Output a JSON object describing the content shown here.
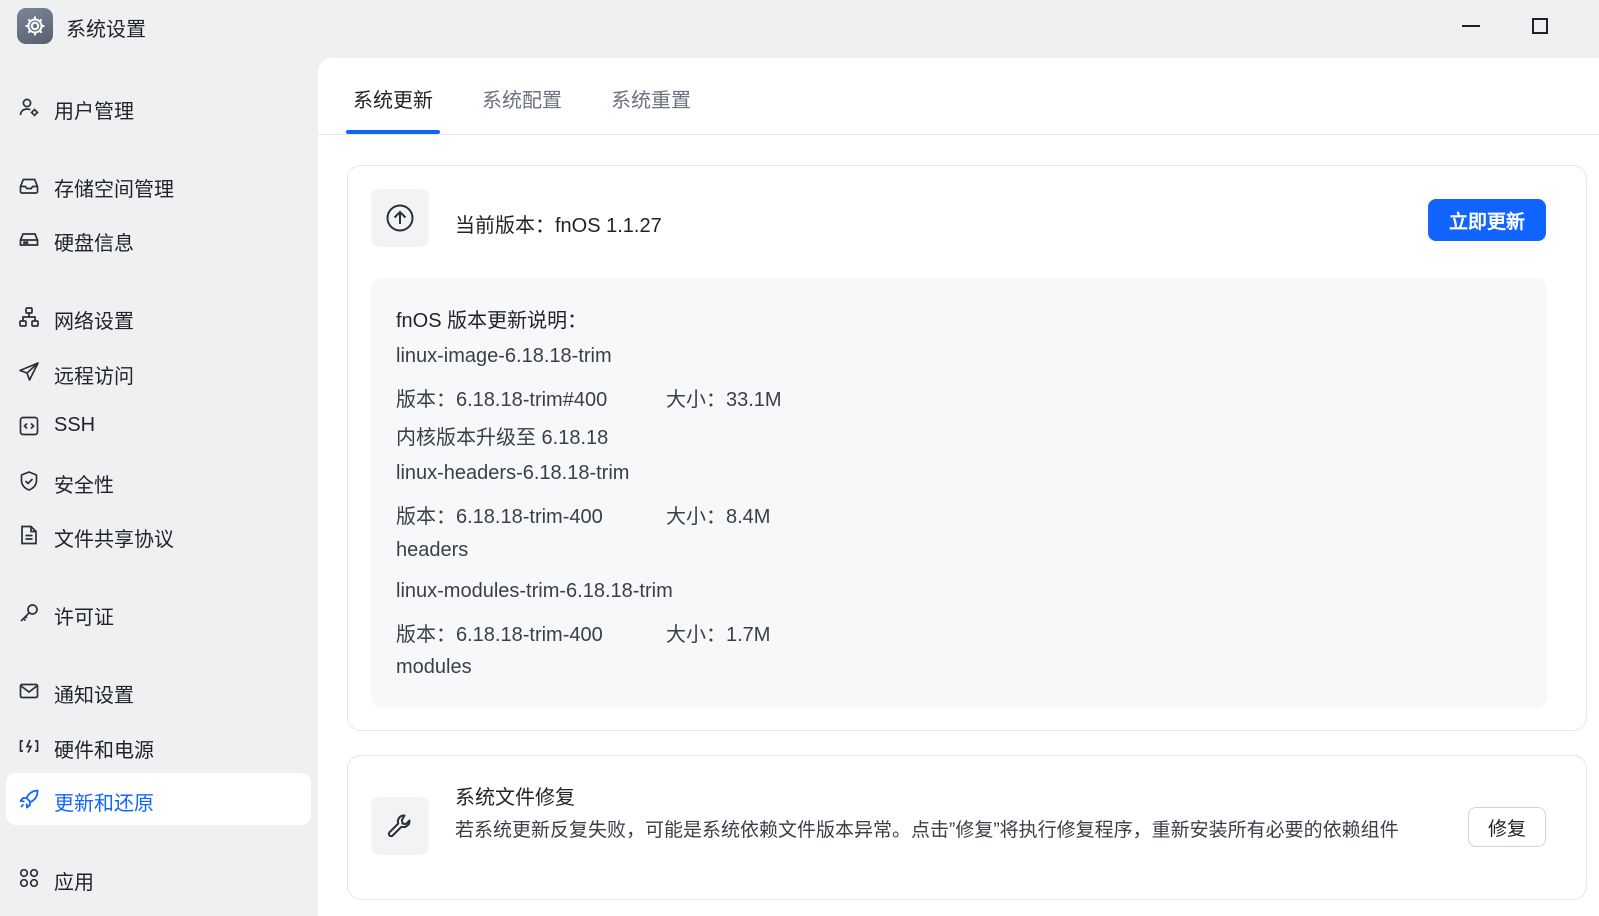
{
  "window": {
    "title": "系统设置",
    "icon": "gear-icon",
    "controls": {
      "minimize": "minimize-icon",
      "maximize": "maximize-icon"
    }
  },
  "sidebar": {
    "items": [
      {
        "label": "用户管理",
        "icon": "user-gear-icon"
      },
      {
        "label": "存储空间管理",
        "icon": "inbox-tray-icon"
      },
      {
        "label": "硬盘信息",
        "icon": "hard-drive-icon"
      },
      {
        "label": "网络设置",
        "icon": "network-icon"
      },
      {
        "label": "远程访问",
        "icon": "paper-plane-icon"
      },
      {
        "label": "SSH",
        "icon": "code-box-icon"
      },
      {
        "label": "安全性",
        "icon": "shield-check-icon"
      },
      {
        "label": "文件共享协议",
        "icon": "document-icon"
      },
      {
        "label": "许可证",
        "icon": "key-icon"
      },
      {
        "label": "通知设置",
        "icon": "mail-icon"
      },
      {
        "label": "硬件和电源",
        "icon": "power-plug-icon"
      },
      {
        "label": "更新和还原",
        "icon": "rocket-icon",
        "active": true
      },
      {
        "label": "应用",
        "icon": "apps-grid-icon"
      }
    ]
  },
  "tabs": [
    {
      "label": "系统更新",
      "active": true
    },
    {
      "label": "系统配置"
    },
    {
      "label": "系统重置"
    }
  ],
  "update": {
    "current_version": "当前版本：fnOS 1.1.27",
    "update_button": "立即更新",
    "notes_title": "fnOS 版本更新说明：",
    "packages": [
      {
        "name": "linux-image-6.18.18-trim",
        "version": "版本：6.18.18-trim#400",
        "size": "大小：33.1M",
        "desc": "内核版本升级至 6.18.18"
      },
      {
        "name": "linux-headers-6.18.18-trim",
        "version": "版本：6.18.18-trim-400",
        "size": "大小：8.4M",
        "desc": "headers"
      },
      {
        "name": "linux-modules-trim-6.18.18-trim",
        "version": "版本：6.18.18-trim-400",
        "size": "大小：1.7M",
        "desc": "modules"
      }
    ]
  },
  "repair": {
    "title": "系统文件修复",
    "description": "若系统更新反复失败，可能是系统依赖文件版本异常。点击”修复”将执行修复程序，重新安装所有必要的依赖组件",
    "button": "修复"
  },
  "colors": {
    "accent": "#1264ff",
    "sidebar_bg": "#eff0f2",
    "panel_bg": "#ffffff",
    "notes_bg": "#f7f8fa"
  }
}
